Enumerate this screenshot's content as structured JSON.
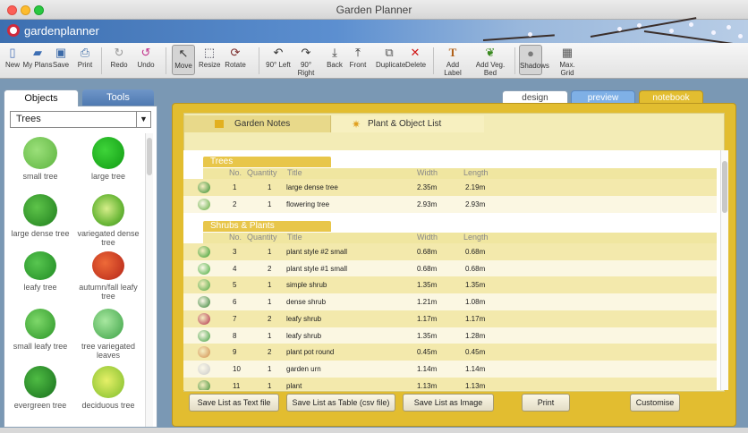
{
  "window": {
    "title": "Garden Planner"
  },
  "brand": {
    "name": "gardenplanner"
  },
  "toolbar": {
    "items": [
      {
        "label": "New",
        "icon": "new-doc"
      },
      {
        "label": "My Plans",
        "icon": "folder"
      },
      {
        "label": "Save",
        "icon": "save-disk"
      },
      {
        "label": "Print",
        "icon": "printer"
      },
      {
        "label": "Redo",
        "icon": "redo-arrow"
      },
      {
        "label": "Undo",
        "icon": "undo-arrow"
      },
      {
        "label": "Move",
        "icon": "cursor-arrow"
      },
      {
        "label": "Resize",
        "icon": "resize-box"
      },
      {
        "label": "Rotate",
        "icon": "rotate"
      },
      {
        "label": "90° Left",
        "icon": "rotate-left"
      },
      {
        "label": "90° Right",
        "icon": "rotate-right"
      },
      {
        "label": "Back",
        "icon": "send-back"
      },
      {
        "label": "Front",
        "icon": "bring-front"
      },
      {
        "label": "Duplicate",
        "icon": "duplicate"
      },
      {
        "label": "Delete",
        "icon": "delete-x"
      },
      {
        "label": "Add Label",
        "icon": "text-t"
      },
      {
        "label": "Add Veg. Bed",
        "icon": "veg-bed"
      },
      {
        "label": "Shadows",
        "icon": "shadow-circle"
      },
      {
        "label": "Max. Grid",
        "icon": "grid"
      }
    ]
  },
  "left_tabs": {
    "objects": "Objects",
    "tools": "Tools"
  },
  "category": {
    "selected": "Trees"
  },
  "objects": [
    "small tree",
    "large tree",
    "large dense tree",
    "variegated dense tree",
    "leafy tree",
    "autumn/fall leafy tree",
    "small leafy tree",
    "tree variegated leaves",
    "evergreen tree",
    "deciduous tree"
  ],
  "view_tabs": {
    "design": "design",
    "preview": "preview",
    "notebook": "notebook"
  },
  "notebook_tabs": {
    "notes": "Garden Notes",
    "list": "Plant & Object List"
  },
  "columns": {
    "no": "No.",
    "quantity": "Quantity",
    "title": "Title",
    "width": "Width",
    "length": "Length"
  },
  "sections": {
    "trees": "Trees",
    "shrubs": "Shrubs & Plants"
  },
  "trees": [
    {
      "no": "1",
      "qty": "1",
      "title": "large dense tree",
      "width": "2.35m",
      "length": "2.19m",
      "color": "#2e8a2a"
    },
    {
      "no": "2",
      "qty": "1",
      "title": "flowering tree",
      "width": "2.93m",
      "length": "2.93m",
      "color": "#5aa838"
    }
  ],
  "shrubs": [
    {
      "no": "3",
      "qty": "1",
      "title": "plant style #2  small",
      "width": "0.68m",
      "length": "0.68m",
      "color": "#2f9a2a"
    },
    {
      "no": "4",
      "qty": "2",
      "title": "plant style #1  small",
      "width": "0.68m",
      "length": "0.68m",
      "color": "#3fa834"
    },
    {
      "no": "5",
      "qty": "1",
      "title": "simple shrub",
      "width": "1.35m",
      "length": "1.35m",
      "color": "#48a43e"
    },
    {
      "no": "6",
      "qty": "1",
      "title": "dense shrub",
      "width": "1.21m",
      "length": "1.08m",
      "color": "#2d7d2d"
    },
    {
      "no": "7",
      "qty": "2",
      "title": "leafy shrub",
      "width": "1.17m",
      "length": "1.17m",
      "color": "#b02a4a"
    },
    {
      "no": "8",
      "qty": "1",
      "title": "leafy shrub",
      "width": "1.35m",
      "length": "1.28m",
      "color": "#3a9a38"
    },
    {
      "no": "9",
      "qty": "2",
      "title": "plant pot  round",
      "width": "0.45m",
      "length": "0.45m",
      "color": "#d08a4a"
    },
    {
      "no": "10",
      "qty": "1",
      "title": "garden urn",
      "width": "1.14m",
      "length": "1.14m",
      "color": "#c8c8c8"
    },
    {
      "no": "11",
      "qty": "1",
      "title": "plant",
      "width": "1.13m",
      "length": "1.13m",
      "color": "#3a8a30"
    }
  ],
  "buttons": {
    "text": "Save List as Text file",
    "csv": "Save List as Table (csv file)",
    "image": "Save List as Image",
    "print": "Print",
    "customise": "Customise"
  },
  "colors": {
    "accent": "#e2bd30",
    "list_odd": "#f3e9ac",
    "section": "#e8c64a"
  }
}
